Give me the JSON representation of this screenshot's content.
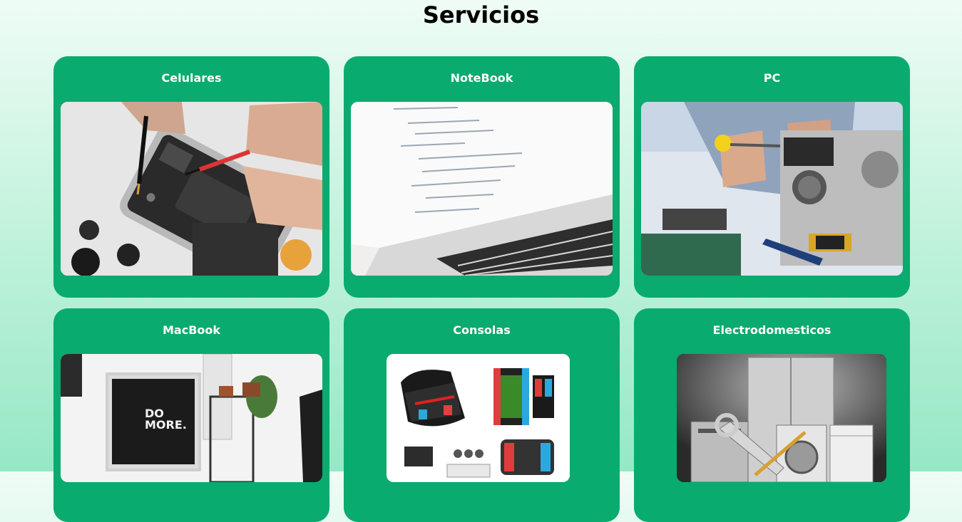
{
  "page": {
    "title": "Servicios"
  },
  "services": [
    {
      "label": "Celulares"
    },
    {
      "label": "NoteBook"
    },
    {
      "label": "PC"
    },
    {
      "label": "MacBook",
      "image_text": "DO MORE."
    },
    {
      "label": "Consolas"
    },
    {
      "label": "Electrodomesticos"
    }
  ]
}
